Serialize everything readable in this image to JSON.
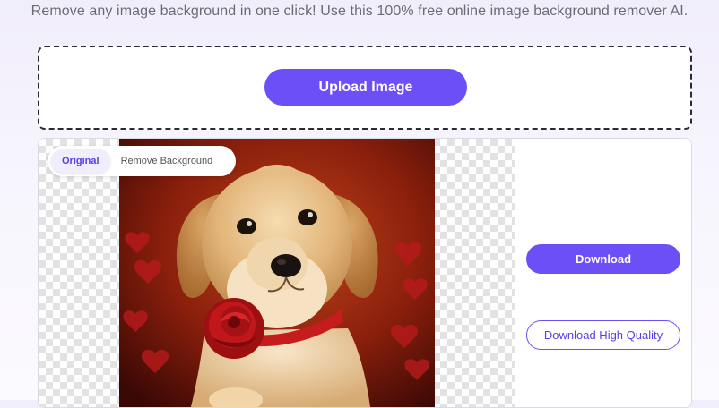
{
  "header": {
    "subtitle": "Remove any image background in one click! Use this 100% free online image background remover AI."
  },
  "upload": {
    "button_label": "Upload Image"
  },
  "preview": {
    "toggle_original": "Original",
    "toggle_remove": "Remove Background",
    "active_toggle": "Original"
  },
  "actions": {
    "download_label": "Download",
    "download_hq_label": "Download High Quality"
  },
  "colors": {
    "accent": "#6c4ff6",
    "accent_text": "#5a3ee8",
    "page_bg": "#f1eefb"
  }
}
